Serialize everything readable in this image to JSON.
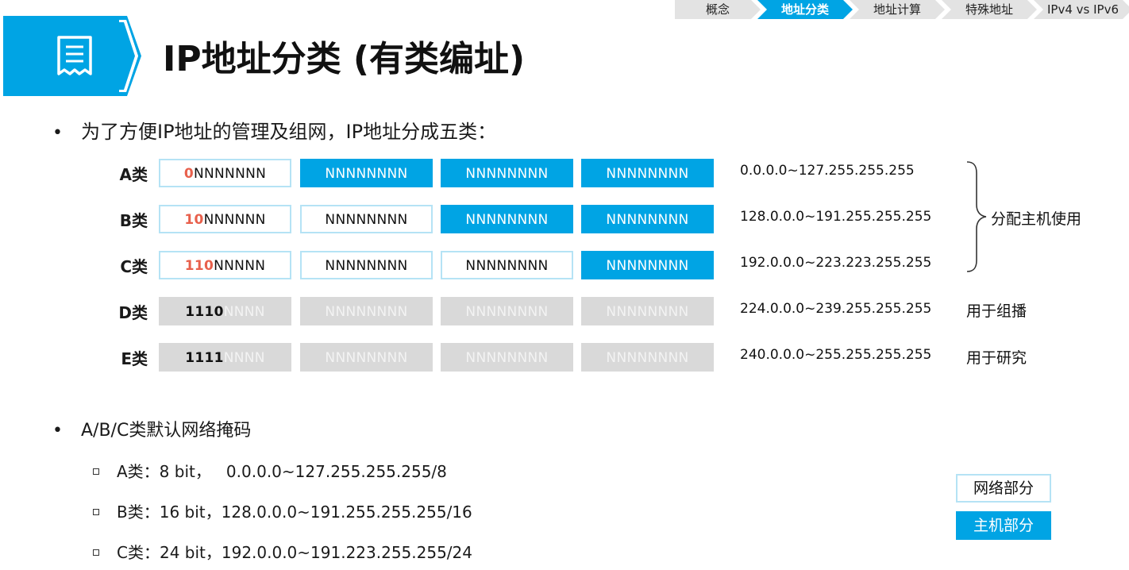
{
  "nav": {
    "items": [
      {
        "label": "概念"
      },
      {
        "label": "地址分类"
      },
      {
        "label": "地址计算"
      },
      {
        "label": "特殊地址"
      },
      {
        "label": "IPv4 vs IPv6"
      }
    ],
    "active_index": 1
  },
  "header": {
    "icon": "document-icon",
    "title": "IP地址分类 (有类编址)"
  },
  "intro": {
    "bullet": "•",
    "text": "为了方便IP地址的管理及组网，IP地址分成五类："
  },
  "classes": [
    {
      "label": "A类",
      "cells": [
        {
          "prefix": "0",
          "rest": "NNNNNNN",
          "kind": "net",
          "prefix_color": "red"
        },
        {
          "prefix": "",
          "rest": "NNNNNNNN",
          "kind": "host"
        },
        {
          "prefix": "",
          "rest": "NNNNNNNN",
          "kind": "host"
        },
        {
          "prefix": "",
          "rest": "NNNNNNNN",
          "kind": "host"
        }
      ],
      "range": "0.0.0.0~127.255.255.255"
    },
    {
      "label": "B类",
      "cells": [
        {
          "prefix": "10",
          "rest": "NNNNNN",
          "kind": "net",
          "prefix_color": "red"
        },
        {
          "prefix": "",
          "rest": "NNNNNNNN",
          "kind": "net"
        },
        {
          "prefix": "",
          "rest": "NNNNNNNN",
          "kind": "host"
        },
        {
          "prefix": "",
          "rest": "NNNNNNNN",
          "kind": "host"
        }
      ],
      "range": "128.0.0.0~191.255.255.255"
    },
    {
      "label": "C类",
      "cells": [
        {
          "prefix": "110",
          "rest": "NNNNN",
          "kind": "net",
          "prefix_color": "red"
        },
        {
          "prefix": "",
          "rest": "NNNNNNNN",
          "kind": "net"
        },
        {
          "prefix": "",
          "rest": "NNNNNNNN",
          "kind": "net"
        },
        {
          "prefix": "",
          "rest": "NNNNNNNN",
          "kind": "host"
        }
      ],
      "range": "192.0.0.0~223.223.255.255"
    },
    {
      "label": "D类",
      "cells": [
        {
          "prefix": "1110",
          "rest": "NNNN",
          "kind": "gray",
          "prefix_color": "dark"
        },
        {
          "prefix": "",
          "rest": "NNNNNNNN",
          "kind": "gray"
        },
        {
          "prefix": "",
          "rest": "NNNNNNNN",
          "kind": "gray"
        },
        {
          "prefix": "",
          "rest": "NNNNNNNN",
          "kind": "gray"
        }
      ],
      "range": "224.0.0.0~239.255.255.255"
    },
    {
      "label": "E类",
      "cells": [
        {
          "prefix": "1111",
          "rest": "NNNN",
          "kind": "gray",
          "prefix_color": "dark"
        },
        {
          "prefix": "",
          "rest": "NNNNNNNN",
          "kind": "gray"
        },
        {
          "prefix": "",
          "rest": "NNNNNNNN",
          "kind": "gray"
        },
        {
          "prefix": "",
          "rest": "NNNNNNNN",
          "kind": "gray"
        }
      ],
      "range": "240.0.0.0~255.255.255.255"
    }
  ],
  "notes": {
    "abc": "分配主机使用",
    "d": "用于组播",
    "e": "用于研究"
  },
  "masks": {
    "bullet": "•",
    "heading": "A/B/C类默认网络掩码",
    "items": [
      {
        "text": "A类：8 bit，   0.0.0.0~127.255.255.255/8"
      },
      {
        "text": "B类：16 bit，128.0.0.0~191.255.255.255/16"
      },
      {
        "text": "C类：24 bit，192.0.0.0~191.223.255.255/24"
      }
    ]
  },
  "legend": {
    "network": "网络部分",
    "host": "主机部分"
  },
  "colors": {
    "accent": "#00a4e4",
    "net_border": "#b5e3f5",
    "gray": "#d9d9d9",
    "prefix_red": "#e8604c"
  }
}
